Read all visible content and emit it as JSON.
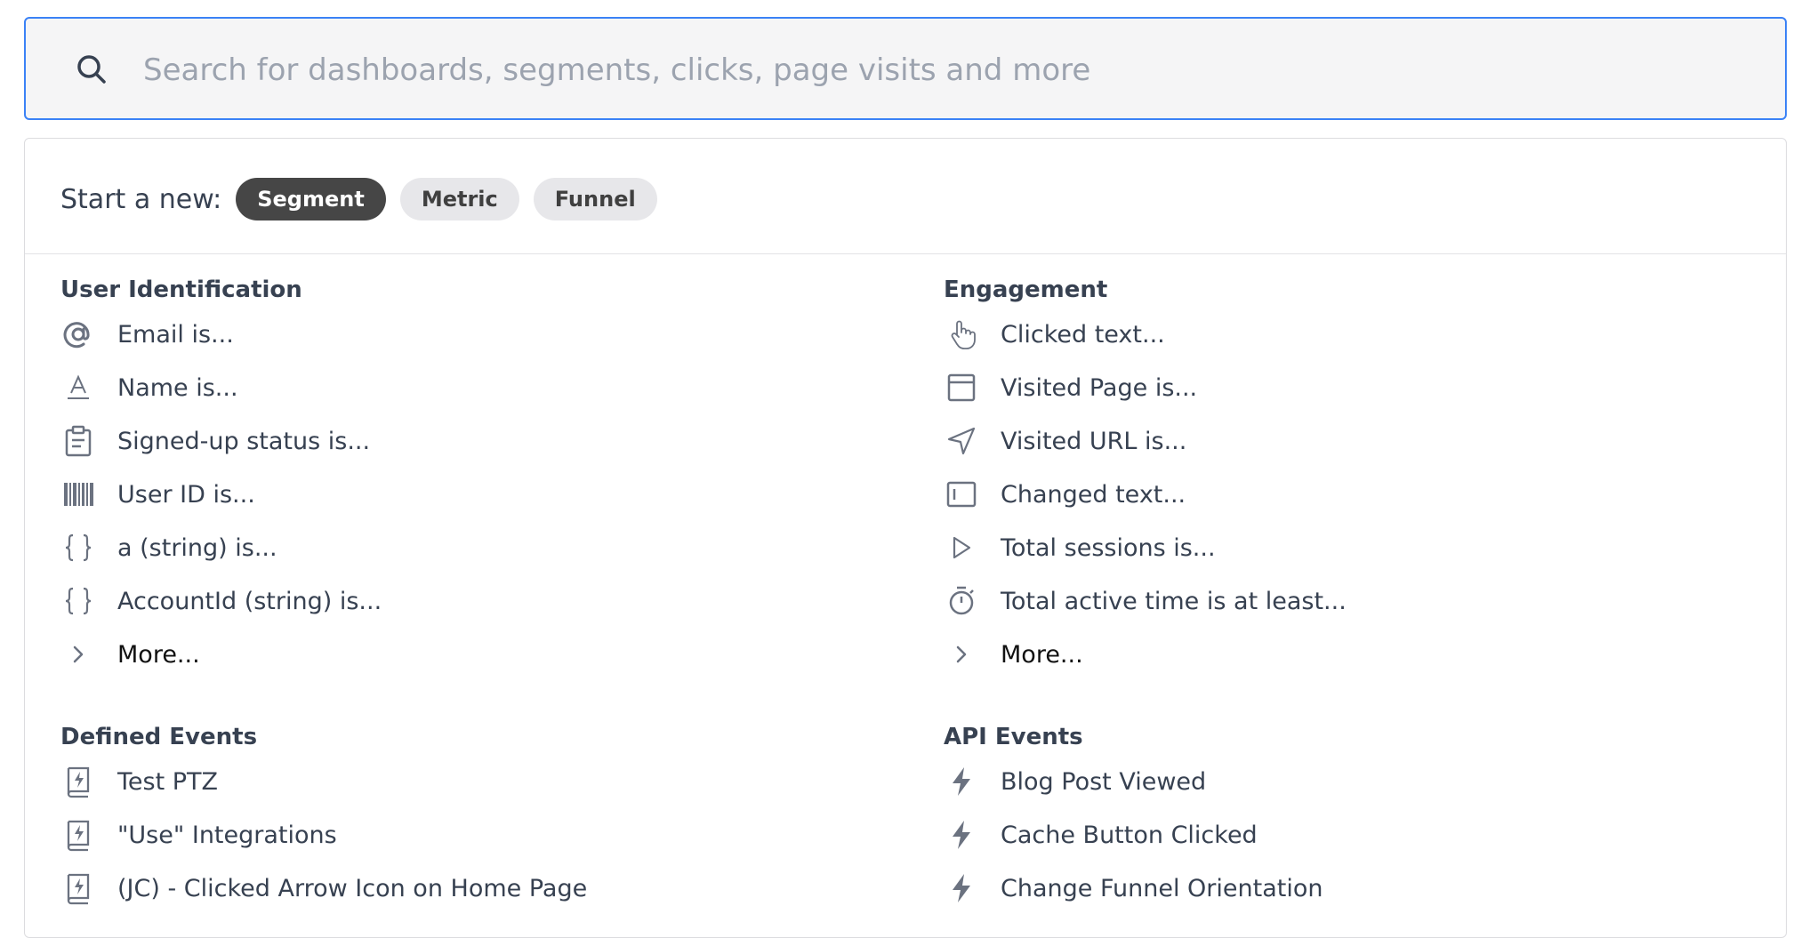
{
  "search": {
    "placeholder": "Search for dashboards, segments, clicks, page visits and more"
  },
  "starter": {
    "label": "Start a new:",
    "chips": [
      "Segment",
      "Metric",
      "Funnel"
    ],
    "active": "Segment"
  },
  "sections": {
    "user_identification": {
      "title": "User Identification",
      "items": [
        {
          "label": "Email is...",
          "icon": "at-icon"
        },
        {
          "label": "Name is...",
          "icon": "text-a-icon"
        },
        {
          "label": "Signed-up status is...",
          "icon": "clipboard-icon"
        },
        {
          "label": "User ID is...",
          "icon": "barcode-icon"
        },
        {
          "label": "a (string) is...",
          "icon": "braces-icon"
        },
        {
          "label": "AccountId (string) is...",
          "icon": "braces-icon"
        },
        {
          "label": "More...",
          "icon": "chevron-right-icon"
        }
      ]
    },
    "engagement": {
      "title": "Engagement",
      "items": [
        {
          "label": "Clicked text...",
          "icon": "pointer-hand-icon"
        },
        {
          "label": "Visited Page is...",
          "icon": "browser-window-icon"
        },
        {
          "label": "Visited URL is...",
          "icon": "navigation-arrow-icon"
        },
        {
          "label": "Changed text...",
          "icon": "text-field-icon"
        },
        {
          "label": "Total sessions is...",
          "icon": "play-icon"
        },
        {
          "label": "Total active time is at least...",
          "icon": "stopwatch-icon"
        },
        {
          "label": "More...",
          "icon": "chevron-right-icon"
        }
      ]
    },
    "defined_events": {
      "title": "Defined Events",
      "items": [
        {
          "label": "Test PTZ",
          "icon": "defined-event-icon"
        },
        {
          "label": "\"Use\" Integrations",
          "icon": "defined-event-icon"
        },
        {
          "label": "(JC) - Clicked Arrow Icon on Home Page",
          "icon": "defined-event-icon"
        }
      ]
    },
    "api_events": {
      "title": "API Events",
      "items": [
        {
          "label": "Blog Post Viewed",
          "icon": "lightning-icon"
        },
        {
          "label": "Cache Button Clicked",
          "icon": "lightning-icon"
        },
        {
          "label": "Change Funnel Orientation",
          "icon": "lightning-icon"
        }
      ]
    }
  },
  "colors": {
    "focus_border": "#3b82f6",
    "chip_active": "#464646",
    "chip": "#e7e7ea",
    "icon": "#6b7280"
  }
}
